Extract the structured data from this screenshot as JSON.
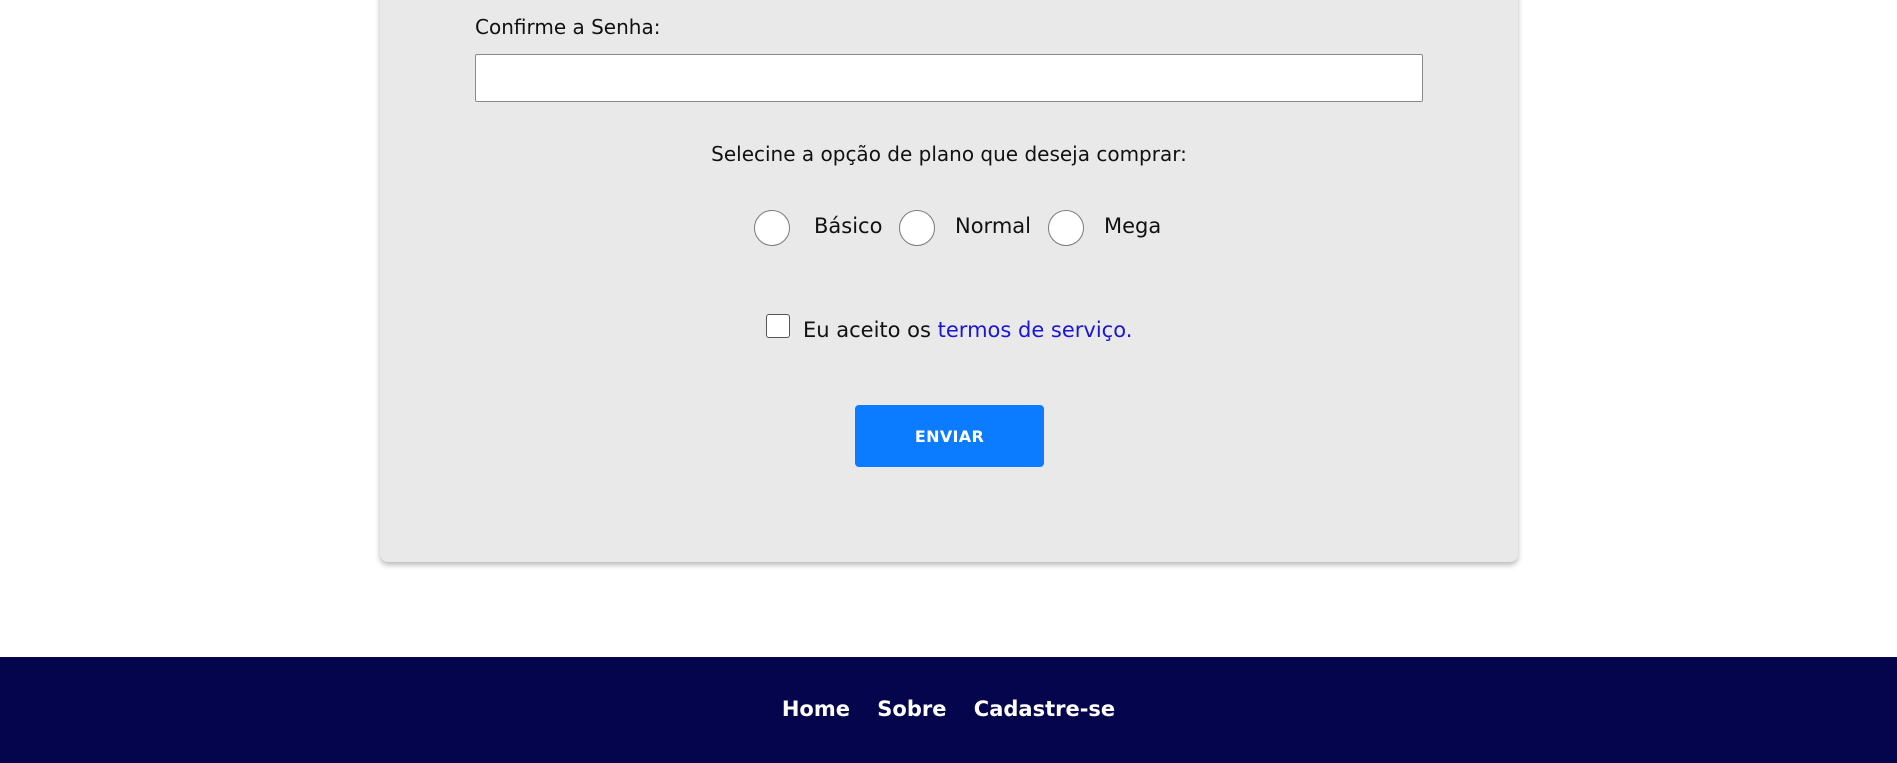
{
  "form": {
    "confirm_password_label": "Confirme a Senha:",
    "confirm_password_value": "",
    "plan_prompt": "Selecine a opção de plano que deseja comprar:",
    "plans": [
      {
        "label": "Básico",
        "selected": false
      },
      {
        "label": "Normal",
        "selected": false
      },
      {
        "label": "Mega",
        "selected": false
      }
    ],
    "terms_prefix": "Eu aceito os ",
    "terms_link": "termos de serviço.",
    "terms_checked": false,
    "submit_label": "ENVIAR"
  },
  "footer": {
    "links": [
      "Home",
      "Sobre",
      "Cadastre-se"
    ]
  },
  "colors": {
    "card_background": "#e9e9e9",
    "button": "#0b7bff",
    "link": "#1a16d4",
    "footer": "#05054d"
  }
}
